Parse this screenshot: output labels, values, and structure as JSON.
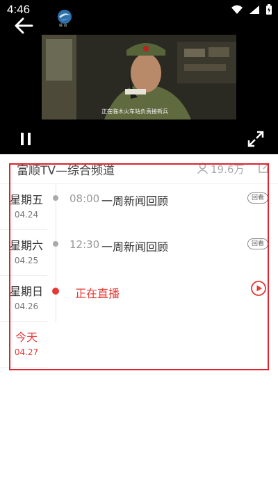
{
  "status_bar": {
    "time": "4:46"
  },
  "player": {
    "logo_text": "综 合",
    "subtitle": "正在临木火车站负责接新兵"
  },
  "channel": {
    "name": "富顺TV—综合频道",
    "viewers": "19.6万"
  },
  "days": [
    {
      "name": "星期五",
      "date": "04.24"
    },
    {
      "name": "星期六",
      "date": "04.25"
    },
    {
      "name": "星期日",
      "date": "04.26"
    },
    {
      "name": "今天",
      "date": "04.27"
    }
  ],
  "programs": [
    {
      "time": "08:00",
      "title": "一周新闻回顾",
      "action": "回看"
    },
    {
      "time": "12:30",
      "title": "一周新闻回顾",
      "action": "回看"
    },
    {
      "title": "正在直播"
    }
  ],
  "colors": {
    "accent": "#e53935",
    "annotation": "#e0202b"
  }
}
